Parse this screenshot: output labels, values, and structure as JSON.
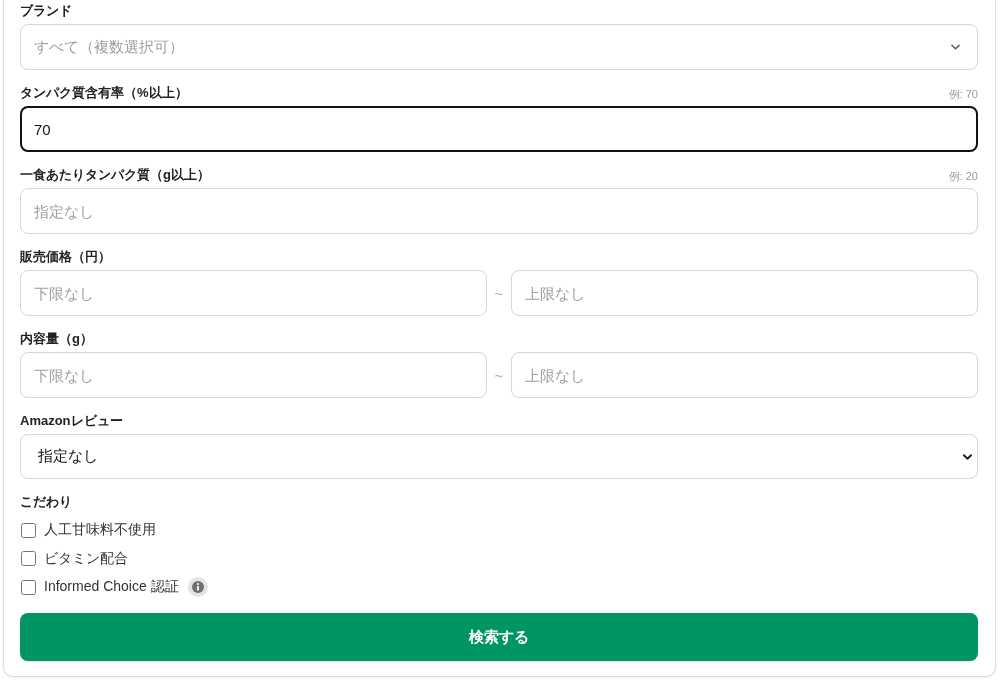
{
  "fields": [
    {
      "kind": "multiselect",
      "label": "ブランド",
      "placeholder": "すべて（複数選択可）"
    },
    {
      "kind": "text",
      "label": "タンパク質含有率（%以上）",
      "hint": "例: 70",
      "value": "70",
      "focused": true
    },
    {
      "kind": "text",
      "label": "一食あたりタンパク質（g以上）",
      "hint": "例: 20",
      "placeholder": "指定なし",
      "focused": false
    },
    {
      "kind": "range",
      "label": "販売価格（円）",
      "inputs": [
        {
          "placeholder": "下限なし"
        },
        {
          "placeholder": "上限なし"
        }
      ],
      "separator": "~"
    },
    {
      "kind": "range",
      "label": "内容量（g）",
      "inputs": [
        {
          "placeholder": "下限なし"
        },
        {
          "placeholder": "上限なし"
        }
      ],
      "separator": "~"
    },
    {
      "kind": "select",
      "label": "Amazonレビュー",
      "value": "指定なし"
    },
    {
      "kind": "checkboxes",
      "label": "こだわり",
      "options": [
        {
          "label": "人工甘味料不使用",
          "checked": false,
          "info": false
        },
        {
          "label": "ビタミン配合",
          "checked": false,
          "info": false
        },
        {
          "label": "Informed Choice 認証",
          "checked": false,
          "info": true
        }
      ]
    }
  ],
  "submit": "検索する"
}
